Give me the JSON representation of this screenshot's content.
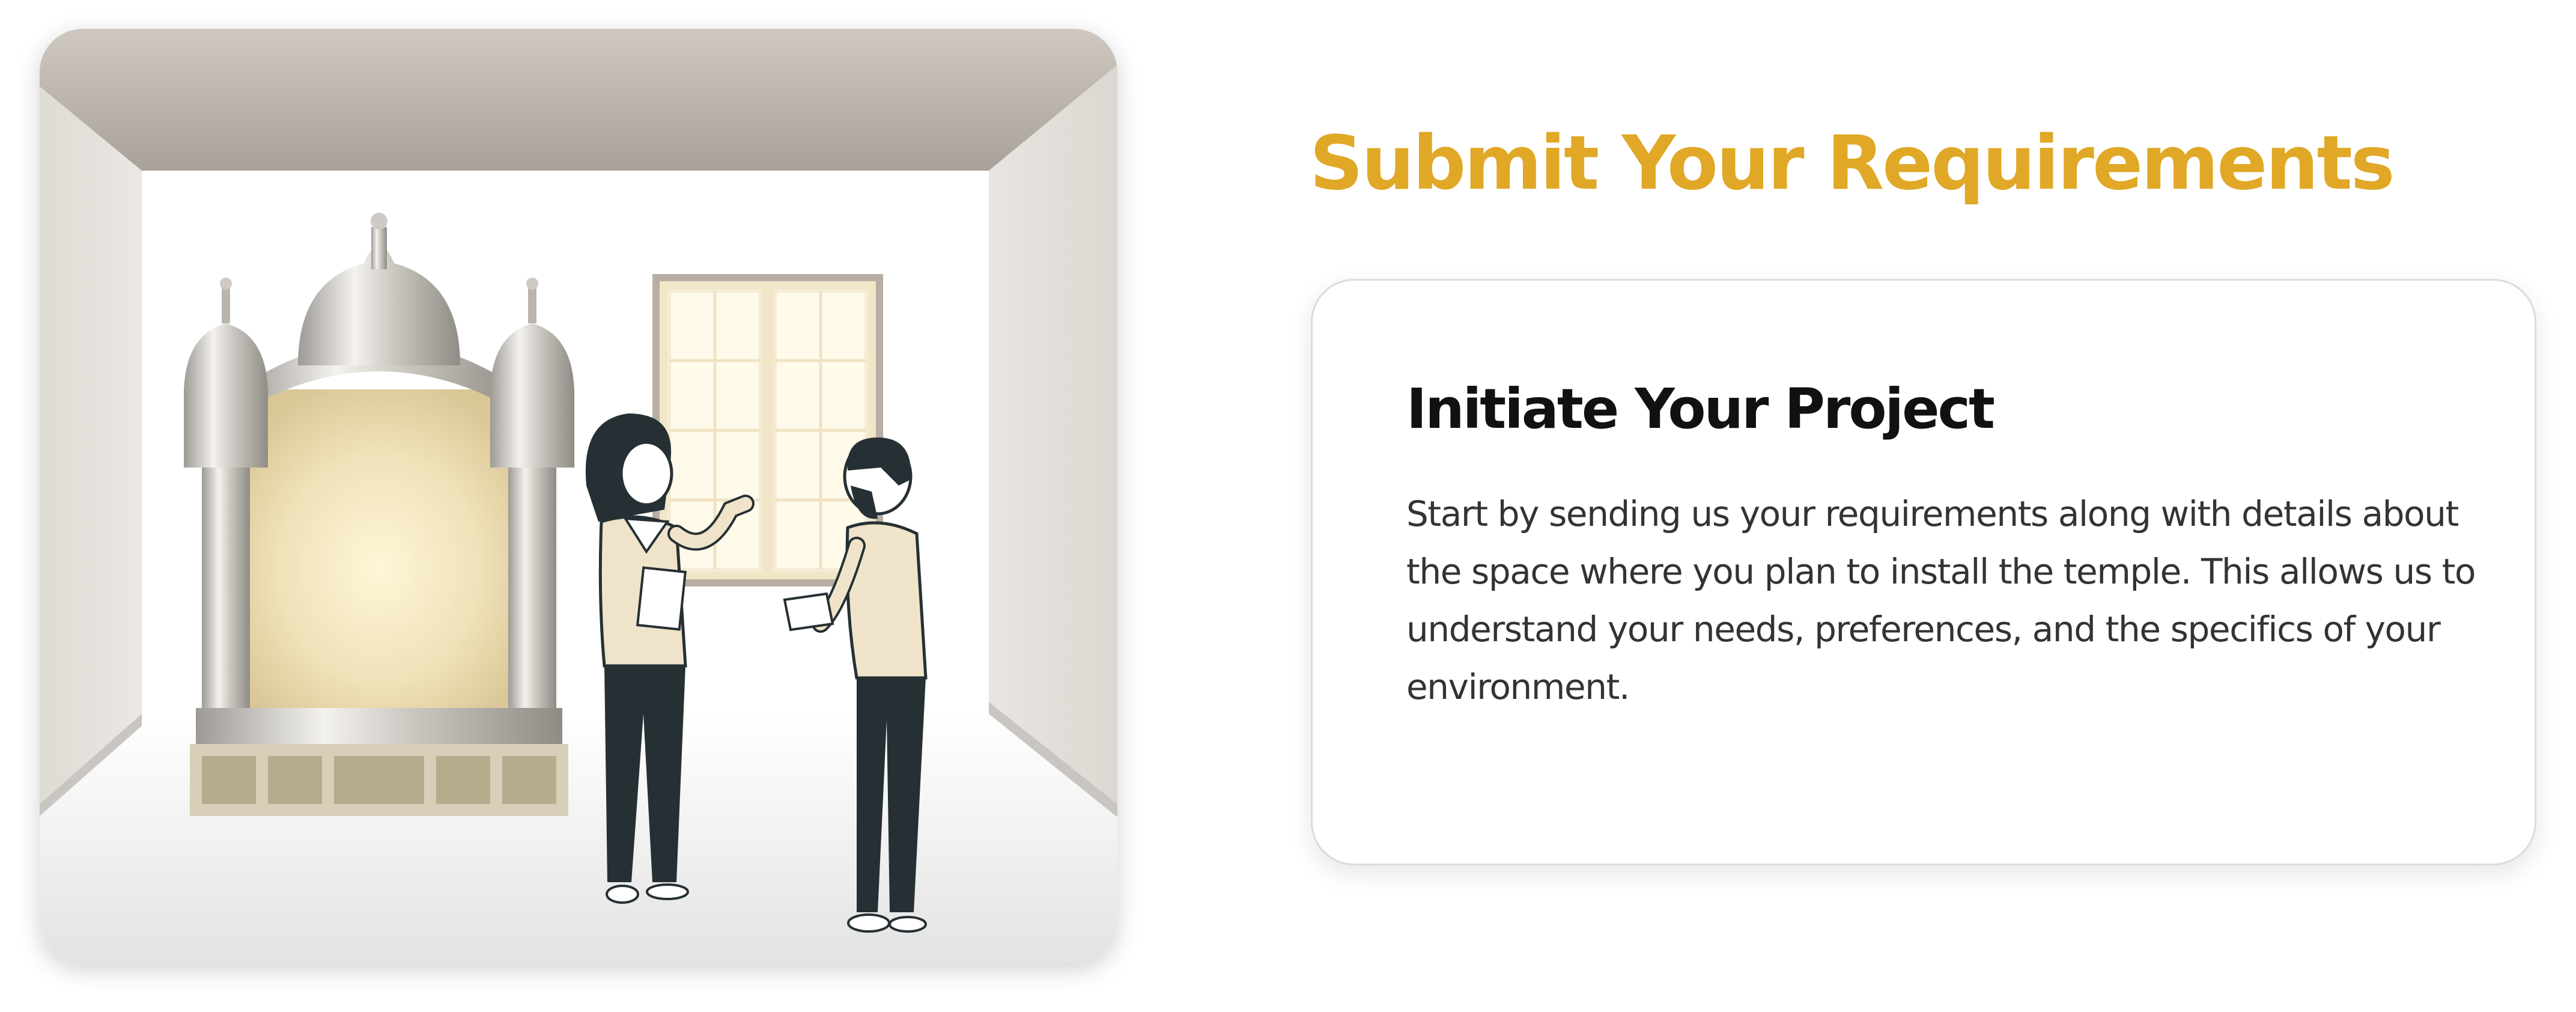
{
  "section": {
    "title": "Submit Your Requirements"
  },
  "step": {
    "title": "Initiate Your Project",
    "description": "Start by sending us your requirements along with details about the space where you plan to install the temple. This allows us to understand your needs, preferences, and the specifics of your environment."
  },
  "colors": {
    "accent": "#E0A826",
    "heading": "#111111",
    "body_text": "#333333",
    "card_border": "#dcdcdc"
  }
}
